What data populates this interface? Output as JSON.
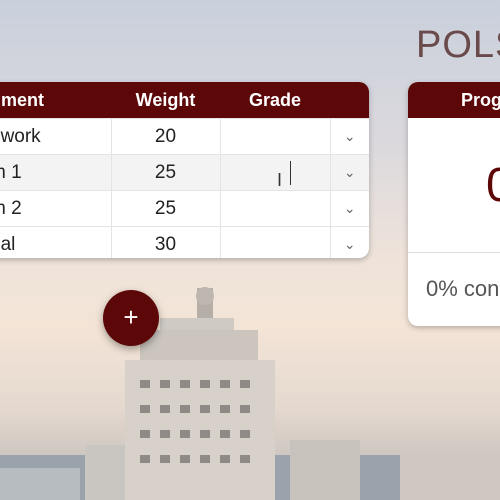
{
  "page_title": "POLS",
  "table": {
    "headers": [
      "nment",
      "Weight",
      "Grade",
      ""
    ],
    "rows": [
      {
        "assignment": "ework",
        "weight": "20",
        "grade": ""
      },
      {
        "assignment": "m 1",
        "weight": "25",
        "grade": ""
      },
      {
        "assignment": "m 2",
        "weight": "25",
        "grade": ""
      },
      {
        "assignment": "nal",
        "weight": "30",
        "grade": ""
      }
    ],
    "row_icon": "chevron-down-icon"
  },
  "add_button": {
    "label": "+",
    "icon": "plus-icon"
  },
  "progress": {
    "header": "Prog",
    "value": "0",
    "text": "0% con"
  },
  "colors": {
    "accent": "#5c0808"
  }
}
